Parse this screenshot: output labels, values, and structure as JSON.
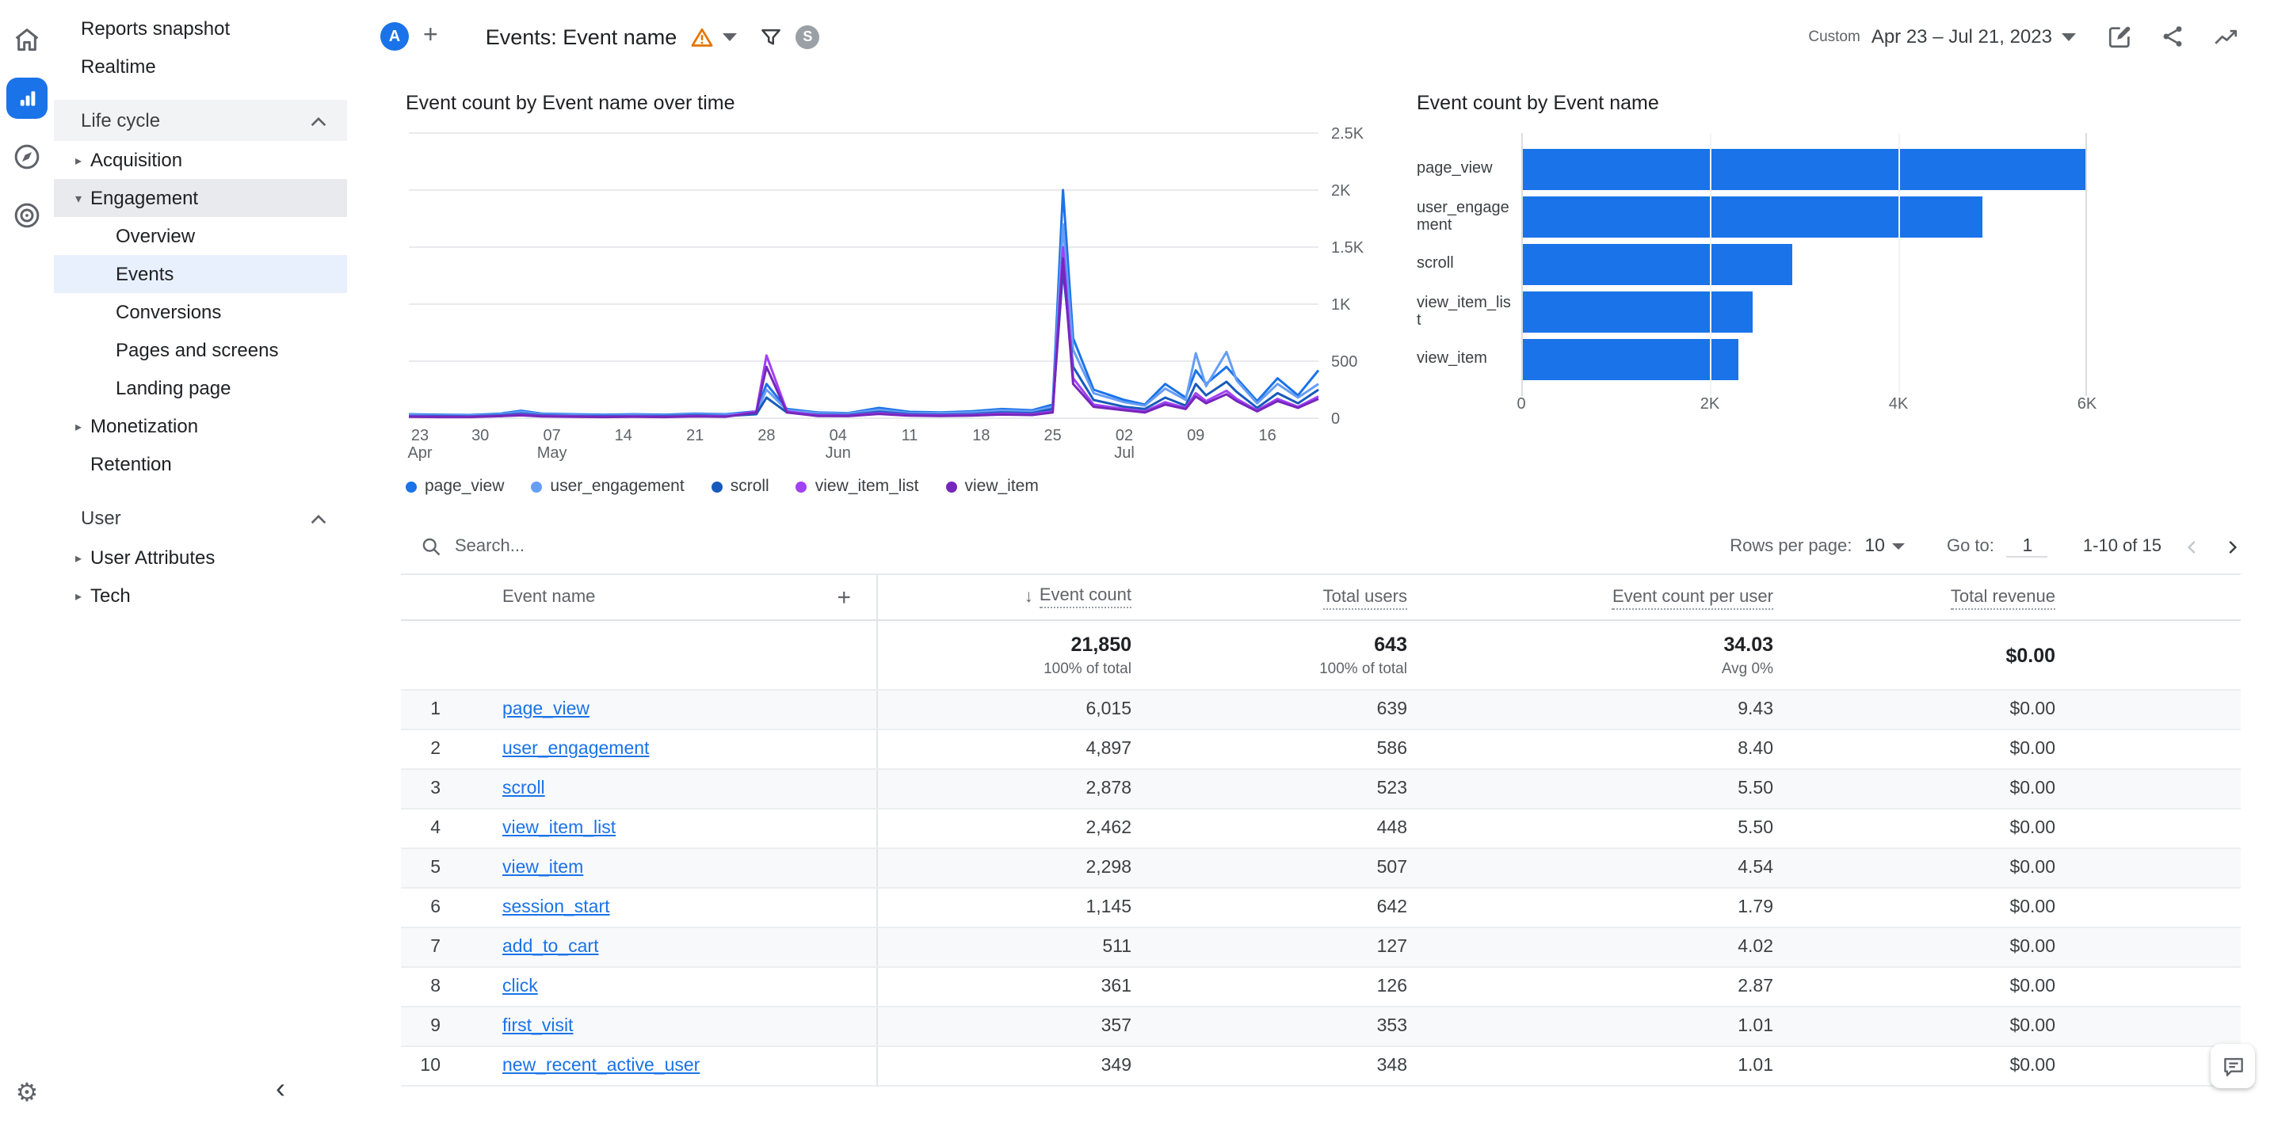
{
  "colors": {
    "accent": "#1a73e8",
    "selected_bg": "#e8f0fe",
    "bar": "#1a73e8",
    "warning": "#e37400"
  },
  "rail": {
    "items": [
      {
        "icon": "home-icon",
        "selected": false
      },
      {
        "icon": "reports-icon",
        "selected": true
      },
      {
        "icon": "explore-icon",
        "selected": false
      },
      {
        "icon": "advertising-icon",
        "selected": false
      }
    ],
    "settings_icon": "gear-icon"
  },
  "sidebar": {
    "items_top": [
      "Reports snapshot",
      "Realtime"
    ],
    "sections": [
      {
        "label": "Life cycle",
        "items": [
          {
            "label": "Acquisition",
            "state": "collapsed"
          },
          {
            "label": "Engagement",
            "state": "expanded",
            "children": [
              {
                "label": "Overview",
                "selected": false
              },
              {
                "label": "Events",
                "selected": true
              },
              {
                "label": "Conversions",
                "selected": false
              },
              {
                "label": "Pages and screens",
                "selected": false
              },
              {
                "label": "Landing page",
                "selected": false
              }
            ]
          },
          {
            "label": "Monetization",
            "state": "collapsed"
          },
          {
            "label": "Retention",
            "state": "none"
          }
        ]
      },
      {
        "label": "User",
        "items": [
          {
            "label": "User Attributes",
            "state": "collapsed"
          },
          {
            "label": "Tech",
            "state": "collapsed"
          }
        ]
      }
    ]
  },
  "header": {
    "avatar_letter": "A",
    "title": "Events: Event name",
    "comparison_badge": "S",
    "date_preset": "Custom",
    "date_range": "Apr 23 – Jul 21, 2023"
  },
  "chart_data": [
    {
      "type": "line",
      "title": "Event count by Event name over time",
      "x_unit": "days since Apr 23, 2023",
      "x_max_day": 89,
      "ylim": [
        0,
        2500
      ],
      "grid": true,
      "legend_position": "bottom",
      "y_ticks": [
        {
          "v": 0,
          "label": "0"
        },
        {
          "v": 500,
          "label": "500"
        },
        {
          "v": 1000,
          "label": "1K"
        },
        {
          "v": 1500,
          "label": "1.5K"
        },
        {
          "v": 2000,
          "label": "2K"
        },
        {
          "v": 2500,
          "label": "2.5K"
        }
      ],
      "x_ticks": [
        {
          "d": 0,
          "label": "23",
          "month": "Apr"
        },
        {
          "d": 7,
          "label": "30"
        },
        {
          "d": 14,
          "label": "07",
          "month": "May"
        },
        {
          "d": 21,
          "label": "14"
        },
        {
          "d": 28,
          "label": "21"
        },
        {
          "d": 35,
          "label": "28"
        },
        {
          "d": 42,
          "label": "04",
          "month": "Jun"
        },
        {
          "d": 49,
          "label": "11"
        },
        {
          "d": 56,
          "label": "18"
        },
        {
          "d": 63,
          "label": "25"
        },
        {
          "d": 70,
          "label": "02",
          "month": "Jul"
        },
        {
          "d": 77,
          "label": "09"
        },
        {
          "d": 84,
          "label": "16"
        }
      ],
      "days": [
        0,
        3,
        6,
        9,
        11,
        13,
        16,
        19,
        22,
        25,
        28,
        31,
        34,
        35,
        37,
        40,
        43,
        46,
        49,
        52,
        55,
        58,
        61,
        63,
        64,
        65,
        67,
        70,
        72,
        74,
        76,
        77,
        78,
        80,
        81,
        83,
        85,
        87,
        89
      ],
      "series": [
        {
          "name": "page_view",
          "color": "#1a73e8",
          "values": [
            35,
            30,
            28,
            40,
            65,
            40,
            35,
            30,
            35,
            30,
            40,
            35,
            60,
            300,
            80,
            50,
            45,
            90,
            55,
            50,
            60,
            80,
            70,
            120,
            2000,
            700,
            250,
            160,
            120,
            300,
            180,
            420,
            300,
            450,
            350,
            150,
            350,
            200,
            420
          ]
        },
        {
          "name": "user_engagement",
          "color": "#669df6",
          "values": [
            30,
            25,
            22,
            35,
            55,
            35,
            30,
            25,
            30,
            25,
            35,
            30,
            50,
            250,
            70,
            45,
            40,
            75,
            45,
            45,
            50,
            70,
            60,
            100,
            1700,
            600,
            220,
            140,
            110,
            260,
            160,
            570,
            280,
            580,
            330,
            130,
            300,
            180,
            300
          ]
        },
        {
          "name": "scroll",
          "color": "#185abc",
          "values": [
            20,
            18,
            15,
            25,
            40,
            25,
            20,
            18,
            20,
            18,
            25,
            20,
            35,
            180,
            50,
            30,
            28,
            55,
            35,
            30,
            35,
            50,
            45,
            80,
            1300,
            450,
            160,
            100,
            80,
            180,
            110,
            300,
            200,
            320,
            230,
            90,
            220,
            130,
            250
          ]
        },
        {
          "name": "view_item_list",
          "color": "#a142f4",
          "values": [
            15,
            12,
            12,
            20,
            30,
            20,
            15,
            12,
            15,
            12,
            20,
            15,
            60,
            550,
            60,
            25,
            22,
            45,
            28,
            25,
            28,
            40,
            35,
            60,
            1500,
            350,
            120,
            80,
            60,
            140,
            90,
            220,
            150,
            240,
            170,
            70,
            170,
            100,
            190
          ]
        },
        {
          "name": "view_item",
          "color": "#7627bb",
          "values": [
            12,
            10,
            10,
            18,
            25,
            15,
            12,
            10,
            12,
            10,
            15,
            12,
            50,
            450,
            50,
            20,
            18,
            38,
            22,
            20,
            22,
            32,
            28,
            50,
            1400,
            300,
            100,
            70,
            50,
            120,
            80,
            190,
            130,
            210,
            150,
            60,
            150,
            90,
            170
          ]
        }
      ]
    },
    {
      "type": "bar",
      "title": "Event count by Event name",
      "orientation": "horizontal",
      "categories": [
        "page_view",
        "user_engagement",
        "scroll",
        "view_item_list",
        "view_item"
      ],
      "values": [
        6015,
        4897,
        2878,
        2462,
        2298
      ],
      "xlim": [
        0,
        6000
      ],
      "bar_color": "#1a73e8",
      "x_ticks": [
        {
          "v": 0,
          "label": "0"
        },
        {
          "v": 2000,
          "label": "2K"
        },
        {
          "v": 4000,
          "label": "4K"
        },
        {
          "v": 6000,
          "label": "6K"
        }
      ]
    }
  ],
  "table": {
    "search_placeholder": "Search...",
    "rows_per_page_label": "Rows per page:",
    "rows_per_page_value": "10",
    "go_to_label": "Go to:",
    "go_to_value": "1",
    "range_label": "1-10 of 15",
    "columns": [
      "Event name",
      "Event count",
      "Total users",
      "Event count per user",
      "Total revenue"
    ],
    "sort_column": "Event count",
    "totals": {
      "event_count": "21,850",
      "event_count_sub": "100% of total",
      "total_users": "643",
      "total_users_sub": "100% of total",
      "per_user": "34.03",
      "per_user_sub": "Avg 0%",
      "revenue": "$0.00"
    },
    "rows": [
      {
        "index": "1",
        "name": "page_view",
        "event_count": "6,015",
        "total_users": "639",
        "per_user": "9.43",
        "revenue": "$0.00"
      },
      {
        "index": "2",
        "name": "user_engagement",
        "event_count": "4,897",
        "total_users": "586",
        "per_user": "8.40",
        "revenue": "$0.00"
      },
      {
        "index": "3",
        "name": "scroll",
        "event_count": "2,878",
        "total_users": "523",
        "per_user": "5.50",
        "revenue": "$0.00"
      },
      {
        "index": "4",
        "name": "view_item_list",
        "event_count": "2,462",
        "total_users": "448",
        "per_user": "5.50",
        "revenue": "$0.00"
      },
      {
        "index": "5",
        "name": "view_item",
        "event_count": "2,298",
        "total_users": "507",
        "per_user": "4.54",
        "revenue": "$0.00"
      },
      {
        "index": "6",
        "name": "session_start",
        "event_count": "1,145",
        "total_users": "642",
        "per_user": "1.79",
        "revenue": "$0.00"
      },
      {
        "index": "7",
        "name": "add_to_cart",
        "event_count": "511",
        "total_users": "127",
        "per_user": "4.02",
        "revenue": "$0.00"
      },
      {
        "index": "8",
        "name": "click",
        "event_count": "361",
        "total_users": "126",
        "per_user": "2.87",
        "revenue": "$0.00"
      },
      {
        "index": "9",
        "name": "first_visit",
        "event_count": "357",
        "total_users": "353",
        "per_user": "1.01",
        "revenue": "$0.00"
      },
      {
        "index": "10",
        "name": "new_recent_active_user",
        "event_count": "349",
        "total_users": "348",
        "per_user": "1.01",
        "revenue": "$0.00"
      }
    ]
  }
}
